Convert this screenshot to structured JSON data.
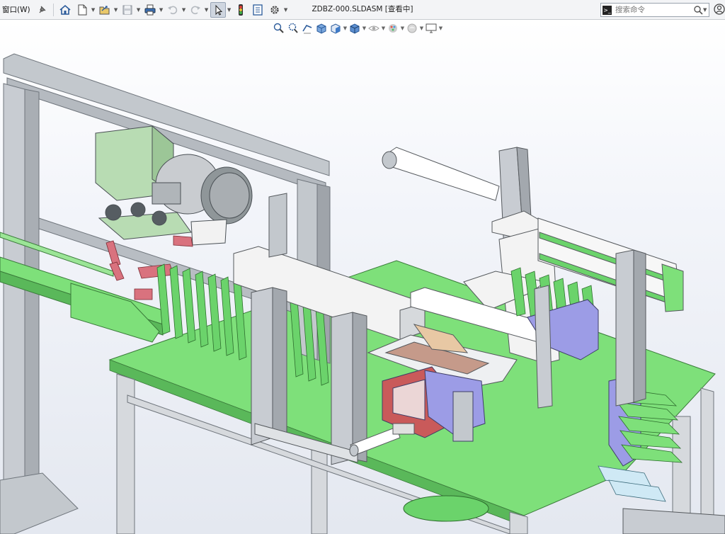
{
  "toolbar": {
    "window_menu_label": "窗口(W)",
    "buttons": [
      "pin-icon",
      "home-icon",
      "new-document-icon",
      "open-document-icon",
      "save-icon",
      "print-icon",
      "undo-icon",
      "redo-icon",
      "select-icon",
      "rebuild-icon",
      "file-properties-icon",
      "options-icon"
    ]
  },
  "document": {
    "title": "ZDBZ-000.SLDASM [查看中]"
  },
  "search": {
    "placeholder": "搜索命令"
  },
  "headsup_toolbar": {
    "buttons": [
      "zoom-to-fit-icon",
      "zoom-to-area-icon",
      "previous-view-icon",
      "section-view-icon",
      "view-orientation-icon",
      "display-style-icon",
      "hide-show-items-icon",
      "edit-appearance-icon",
      "apply-scene-icon",
      "view-settings-icon"
    ]
  },
  "colors": {
    "frame": "#b9bec4",
    "plate_green": "#7ee07a",
    "part_green": "#63cf63",
    "lavender": "#9c9ce6",
    "pink": "#d9727e",
    "red_block": "#c95a5a",
    "gray_motor": "#8f9699",
    "pale_green_motor": "#b8dcb3"
  }
}
